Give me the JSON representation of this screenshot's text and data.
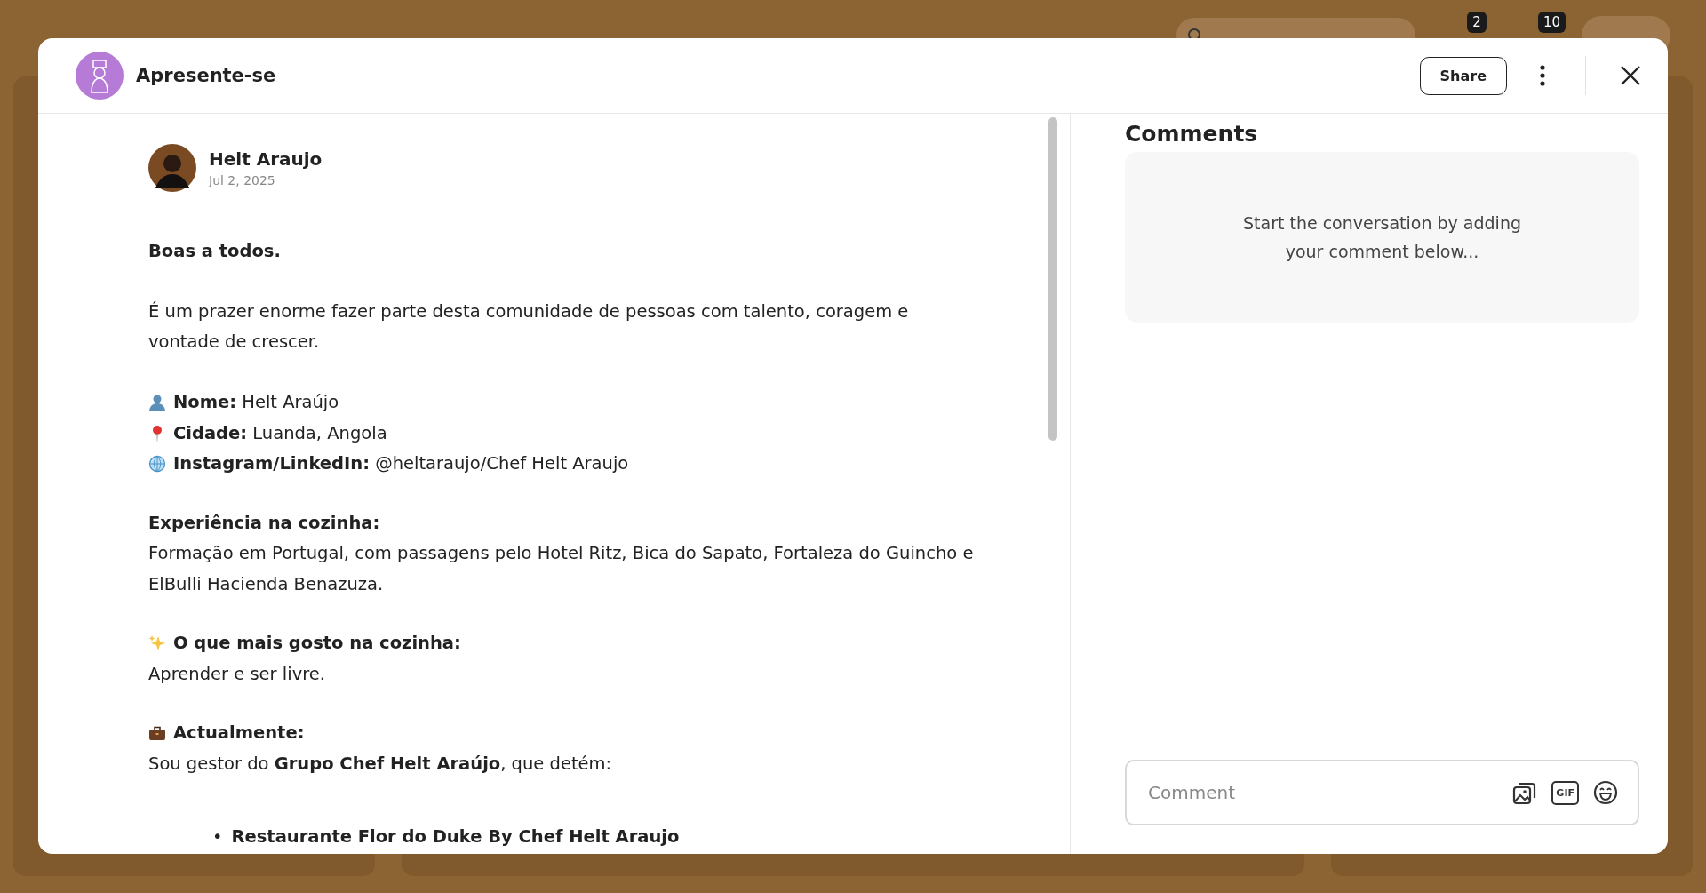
{
  "background": {
    "badges": [
      "2",
      "10"
    ]
  },
  "modal": {
    "title": "Apresente-se",
    "share": "Share"
  },
  "post": {
    "author": "Helt Araujo",
    "date": "Jul 2, 2025",
    "blocks": [
      {
        "kind": "para",
        "text": "**Boas a todos.**"
      },
      {
        "kind": "para",
        "text": "É um prazer enorme fazer parte desta comunidade de pessoas com talento, coragem e vontade de crescer."
      },
      {
        "kind": "lines",
        "lines": [
          {
            "kind": "person",
            "text": "**Nome:** Helt Araújo"
          },
          {
            "kind": "pin",
            "text": "**Cidade:** Luanda, Angola"
          },
          {
            "kind": "globe",
            "text": "**Instagram/LinkedIn:** @heltaraujo/Chef Helt Araujo"
          }
        ]
      },
      {
        "kind": "lines",
        "lines": [
          {
            "kind": "plain",
            "text": "**Experiência na cozinha:**"
          },
          {
            "kind": "plain",
            "text": "Formação em Portugal, com passagens pelo Hotel Ritz, Bica do Sapato, Fortaleza do Guincho e ElBulli Hacienda Benazuza."
          }
        ]
      },
      {
        "kind": "lines",
        "lines": [
          {
            "kind": "sparkle",
            "text": "**O que mais gosto na cozinha:**"
          },
          {
            "kind": "plain",
            "text": "Aprender e ser livre."
          }
        ]
      },
      {
        "kind": "lines",
        "lines": [
          {
            "kind": "briefcase",
            "text": "**Actualmente:**"
          },
          {
            "kind": "plain",
            "text": "Sou gestor do **Grupo Chef Helt Araújo**, que detém:"
          }
        ]
      },
      {
        "kind": "bullets",
        "items": [
          {
            "marker": "•",
            "text": "**Restaurante Flor do Duke By Chef Helt Araujo**"
          }
        ]
      }
    ]
  },
  "comments": {
    "title": "Comments",
    "empty": "Start the conversation by adding your comment below...",
    "input": {
      "placeholder": "Comment"
    },
    "gif": "GIF"
  }
}
